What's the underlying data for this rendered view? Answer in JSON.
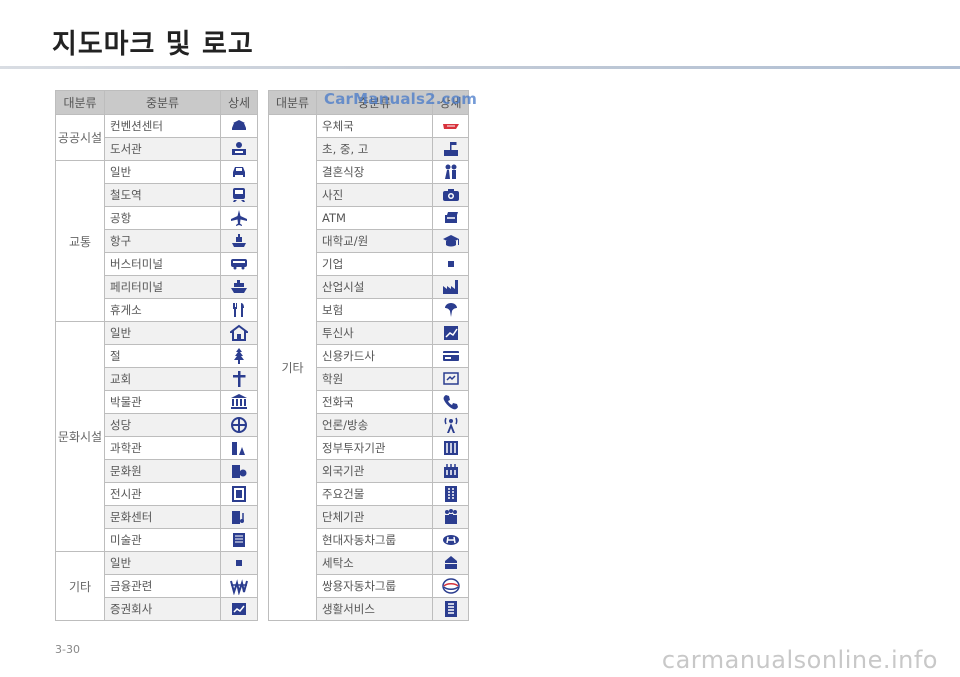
{
  "title": "지도마크 및 로고",
  "page_number": "3-30",
  "watermark_top": "CarManuals2.com",
  "watermark_bottom": "carmanualsonline.info",
  "colors": {
    "icon": "#2b3d8f",
    "header_bg": "#c9c9c9",
    "alt_row": "#f1f1f1"
  },
  "headers": {
    "major": "대분류",
    "minor": "중분류",
    "detail": "상세"
  },
  "left_table": [
    {
      "major": "공공시설",
      "items": [
        {
          "label": "컨벤션센터",
          "icon": "convention-icon"
        },
        {
          "label": "도서관",
          "icon": "library-icon"
        }
      ]
    },
    {
      "major": "교통",
      "items": [
        {
          "label": "일반",
          "icon": "car-icon"
        },
        {
          "label": "철도역",
          "icon": "train-icon"
        },
        {
          "label": "공항",
          "icon": "airplane-icon"
        },
        {
          "label": "항구",
          "icon": "ship-icon"
        },
        {
          "label": "버스터미널",
          "icon": "bus-icon"
        },
        {
          "label": "페리터미널",
          "icon": "ferry-icon"
        },
        {
          "label": "휴게소",
          "icon": "rest-area-icon"
        }
      ]
    },
    {
      "major": "문화시설",
      "items": [
        {
          "label": "일반",
          "icon": "house-icon"
        },
        {
          "label": "절",
          "icon": "temple-icon"
        },
        {
          "label": "교회",
          "icon": "cross-icon"
        },
        {
          "label": "박물관",
          "icon": "museum-icon"
        },
        {
          "label": "성당",
          "icon": "cathedral-icon"
        },
        {
          "label": "과학관",
          "icon": "science-icon"
        },
        {
          "label": "문화원",
          "icon": "culture-icon"
        },
        {
          "label": "전시관",
          "icon": "exhibition-icon"
        },
        {
          "label": "문화센터",
          "icon": "culture-center-icon"
        },
        {
          "label": "미술관",
          "icon": "gallery-icon"
        }
      ]
    },
    {
      "major": "기타",
      "items": [
        {
          "label": "일반",
          "icon": "dot-icon"
        },
        {
          "label": "금융관련",
          "icon": "won-icon"
        },
        {
          "label": "증권회사",
          "icon": "stock-icon"
        }
      ]
    }
  ],
  "right_table": [
    {
      "major": "기타",
      "items": [
        {
          "label": "우체국",
          "icon": "post-office-icon"
        },
        {
          "label": "초, 중, 고",
          "icon": "school-icon"
        },
        {
          "label": "결혼식장",
          "icon": "wedding-icon"
        },
        {
          "label": "사진",
          "icon": "camera-icon"
        },
        {
          "label": "ATM",
          "icon": "atm-icon"
        },
        {
          "label": "대학교/원",
          "icon": "university-icon"
        },
        {
          "label": "기업",
          "icon": "dot-icon"
        },
        {
          "label": "산업시설",
          "icon": "factory-icon"
        },
        {
          "label": "보험",
          "icon": "insurance-icon"
        },
        {
          "label": "투신사",
          "icon": "investment-icon"
        },
        {
          "label": "신용카드사",
          "icon": "credit-card-icon"
        },
        {
          "label": "학원",
          "icon": "academy-icon"
        },
        {
          "label": "전화국",
          "icon": "phone-icon"
        },
        {
          "label": "언론/방송",
          "icon": "antenna-icon"
        },
        {
          "label": "정부투자기관",
          "icon": "government-icon"
        },
        {
          "label": "외국기관",
          "icon": "foreign-office-icon"
        },
        {
          "label": "주요건물",
          "icon": "building-icon"
        },
        {
          "label": "단체기관",
          "icon": "group-icon"
        },
        {
          "label": "현대자동차그룹",
          "icon": "hyundai-logo-icon"
        },
        {
          "label": "세탁소",
          "icon": "laundry-icon"
        },
        {
          "label": "쌍용자동차그룹",
          "icon": "ssangyong-logo-icon"
        },
        {
          "label": "생활서비스",
          "icon": "service-icon"
        }
      ]
    }
  ]
}
